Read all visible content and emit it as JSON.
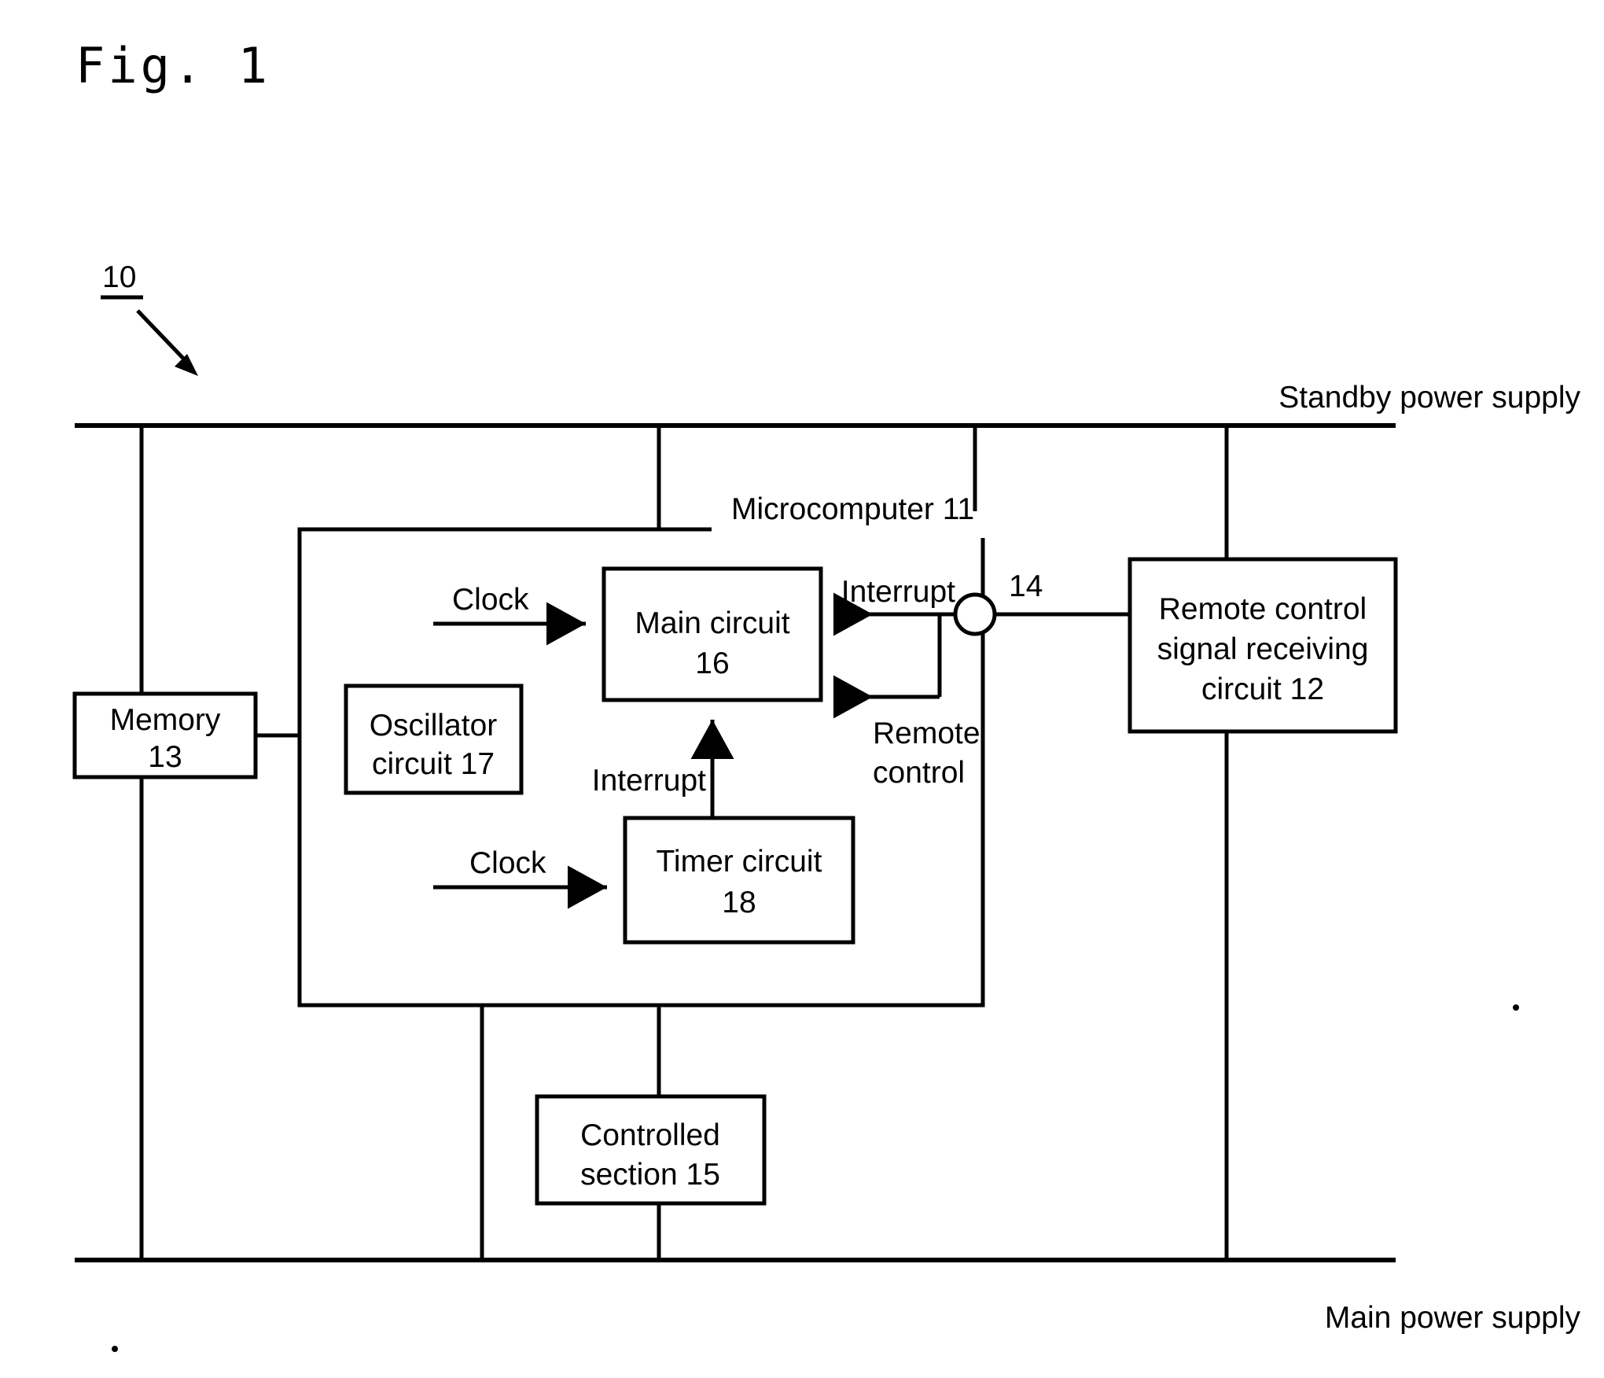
{
  "figure": {
    "title": "Fig. 1",
    "reference_numeral": "10"
  },
  "rails": {
    "standby_label": "Standby power supply",
    "main_label": "Main power supply"
  },
  "microcomputer": {
    "label": "Microcomputer  11"
  },
  "blocks": {
    "main_circuit": {
      "line1": "Main circuit",
      "line2": "16"
    },
    "oscillator_circuit": {
      "line1": "Oscillator",
      "line2": "circuit 17"
    },
    "timer_circuit": {
      "line1": "Timer circuit",
      "line2": "18"
    },
    "memory": {
      "line1": "Memory",
      "line2": "13"
    },
    "controlled_section": {
      "line1": "Controlled",
      "line2": "section 15"
    },
    "remote_receiver": {
      "line1": "Remote control",
      "line2": "signal receiving",
      "line3": "circuit 12"
    }
  },
  "signals": {
    "clock_top": "Clock",
    "clock_bottom": "Clock",
    "interrupt_timer": "Interrupt",
    "interrupt_remote": "Interrupt",
    "remote_control_line1": "Remote",
    "remote_control_line2": "control",
    "node_14": "14"
  },
  "colors": {
    "ink": "#000000",
    "paper": "#ffffff"
  }
}
